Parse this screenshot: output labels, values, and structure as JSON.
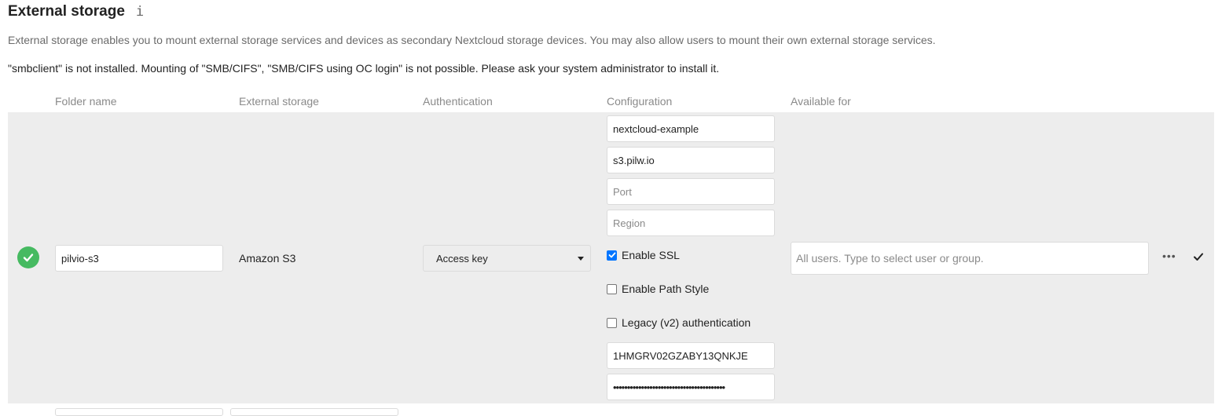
{
  "header": {
    "title": "External storage",
    "info_icon": "i",
    "description": "External storage enables you to mount external storage services and devices as secondary Nextcloud storage devices. You may also allow users to mount their own external storage services.",
    "warning": "\"smbclient\" is not installed. Mounting of \"SMB/CIFS\", \"SMB/CIFS using OC login\" is not possible. Please ask your system administrator to install it."
  },
  "columns": {
    "folder_name": "Folder name",
    "external_storage": "External storage",
    "authentication": "Authentication",
    "configuration": "Configuration",
    "available_for": "Available for"
  },
  "mount": {
    "status": "success",
    "status_color": "#46ba61",
    "folder_name": "pilvio-s3",
    "storage": "Amazon S3",
    "auth_method": "Access key",
    "config": {
      "bucket": "nextcloud-example",
      "hostname": "s3.pilw.io",
      "port": "",
      "port_placeholder": "Port",
      "region": "",
      "region_placeholder": "Region",
      "enable_ssl": {
        "label": "Enable SSL",
        "checked": true
      },
      "enable_path_style": {
        "label": "Enable Path Style",
        "checked": false
      },
      "legacy_auth": {
        "label": "Legacy (v2) authentication",
        "checked": false
      },
      "access_key": "1HMGRV02GZABY13QNKJE",
      "secret_key": "••••••••••••••••••••••••••••••••••••••••"
    },
    "available_for_placeholder": "All users. Type to select user or group.",
    "more_icon": "more-icon",
    "save_icon": "checkmark-icon"
  },
  "colors": {
    "row_background": "#ededed",
    "checkbox_accent": "#0075ff"
  }
}
